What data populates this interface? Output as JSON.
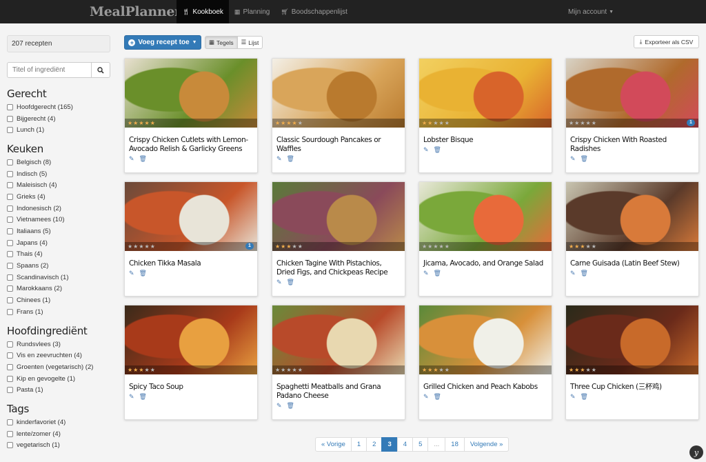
{
  "nav": {
    "brand": "MealPlanner",
    "items": [
      {
        "label": "Kookboek",
        "icon": "cutlery-icon"
      },
      {
        "label": "Planning",
        "icon": "calendar-icon"
      },
      {
        "label": "Boodschappenlijst",
        "icon": "cart-icon"
      }
    ],
    "account": "Mijn account"
  },
  "sidebar": {
    "count": "207 recepten",
    "search_placeholder": "Titel of ingrediënt",
    "facets": [
      {
        "title": "Gerecht",
        "items": [
          "Hoofdgerecht (165)",
          "Bijgerecht (4)",
          "Lunch (1)"
        ]
      },
      {
        "title": "Keuken",
        "items": [
          "Belgisch (8)",
          "Indisch (5)",
          "Maleisisch (4)",
          "Grieks (4)",
          "Indonesisch (2)",
          "Vietnamees (10)",
          "Italiaans (5)",
          "Japans (4)",
          "Thais (4)",
          "Spaans (2)",
          "Scandinavisch (1)",
          "Marokkaans (2)",
          "Chinees (1)",
          "Frans (1)"
        ]
      },
      {
        "title": "Hoofdingrediënt",
        "items": [
          "Rundsvlees (3)",
          "Vis en zeevruchten (4)",
          "Groenten (vegetarisch) (2)",
          "Kip en gevogelte (1)",
          "Pasta (1)"
        ]
      },
      {
        "title": "Tags",
        "items": [
          "kinderfavoriet (4)",
          "lente/zomer (4)",
          "vegetarisch (1)"
        ]
      }
    ]
  },
  "toolbar": {
    "add_label": "Voeg recept toe",
    "view_tiles": "Tegels",
    "view_list": "Lijst",
    "export_label": "Exporteer als CSV"
  },
  "recipes": [
    {
      "title": "Crispy Chicken Cutlets with Lemon-Avocado Relish & Garlicky Greens",
      "rating": 5,
      "badge": "",
      "colors": [
        "#6a8f2a",
        "#c88a3a",
        "#e8e0d0"
      ]
    },
    {
      "title": "Classic Sourdough Pancakes or Waffles",
      "rating": 4,
      "badge": "",
      "colors": [
        "#d9a55a",
        "#b97a2e",
        "#f3efe6"
      ]
    },
    {
      "title": "Lobster Bisque",
      "rating": 2,
      "badge": "",
      "colors": [
        "#e9b233",
        "#d8642a",
        "#f2d060"
      ]
    },
    {
      "title": "Crispy Chicken With Roasted Radishes",
      "rating": 0,
      "badge": "1",
      "colors": [
        "#b06a2c",
        "#d24a5a",
        "#d8d2c4"
      ]
    },
    {
      "title": "Chicken Tikka Masala",
      "rating": 0,
      "badge": "1",
      "colors": [
        "#c8562a",
        "#e8e4d8",
        "#6b4a3a"
      ]
    },
    {
      "title": "Chicken Tagine With Pistachios, Dried Figs, and Chickpeas Recipe",
      "rating": 3,
      "badge": "",
      "colors": [
        "#8a4a5a",
        "#b98a4a",
        "#5a7a3a"
      ]
    },
    {
      "title": "Jicama, Avocado, and Orange Salad",
      "rating": 0,
      "badge": "",
      "colors": [
        "#7aa83a",
        "#e86a3a",
        "#e8e8d8"
      ]
    },
    {
      "title": "Carne Guisada (Latin Beef Stew)",
      "rating": 3,
      "badge": "",
      "colors": [
        "#5a3a2a",
        "#d87a3a",
        "#c8c4b0"
      ]
    },
    {
      "title": "Spicy Taco Soup",
      "rating": 3,
      "badge": "",
      "colors": [
        "#a83a1a",
        "#e8a040",
        "#3a2a1a"
      ]
    },
    {
      "title": "Spaghetti Meatballs and Grana Padano Cheese",
      "rating": 0,
      "badge": "",
      "colors": [
        "#b84a2a",
        "#e8d8b0",
        "#6a8a3a"
      ]
    },
    {
      "title": "Grilled Chicken and Peach Kabobs",
      "rating": 3,
      "badge": "",
      "colors": [
        "#d8903a",
        "#f0f0e8",
        "#5a8a3a"
      ]
    },
    {
      "title": "Three Cup Chicken (三杯鸡)",
      "rating": 3,
      "badge": "",
      "colors": [
        "#6a2a1a",
        "#c86a2a",
        "#2a2a1a"
      ]
    }
  ],
  "pagination": [
    "« Vorige",
    "1",
    "2",
    "3",
    "4",
    "5",
    "...",
    "18",
    "Volgende »"
  ],
  "pagination_active": "3",
  "fab_label": "y",
  "accent": "#337ab7"
}
